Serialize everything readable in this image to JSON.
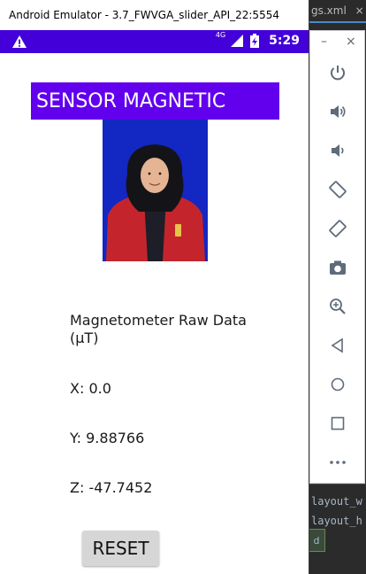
{
  "emulator": {
    "window_title": "Android Emulator - 3.7_FWVGA_slider_API_22:5554"
  },
  "status_bar": {
    "network_label": "4G",
    "time": "5:29",
    "color": "#4300d9"
  },
  "app": {
    "title": "SENSOR MAGNETIC",
    "title_bg": "#6200ee",
    "raw_label": "Magnetometer Raw Data (µT)",
    "x_text": "X: 0.0",
    "y_text": "Y: 9.88766",
    "z_text": "Z: -47.7452",
    "reset_label": "RESET"
  },
  "side_panel": {
    "minimize": "–",
    "close": "×",
    "buttons": [
      "power-icon",
      "volume-up-icon",
      "volume-down-icon",
      "rotate-left-icon",
      "rotate-right-icon",
      "camera-icon",
      "zoom-icon",
      "back-icon",
      "home-icon",
      "overview-icon",
      "more-icon"
    ]
  },
  "ide": {
    "tab_label": "gs.xml",
    "tab_close": "×",
    "code_lines": [
      "layout_w",
      "layout_h"
    ],
    "green_label": "d"
  }
}
